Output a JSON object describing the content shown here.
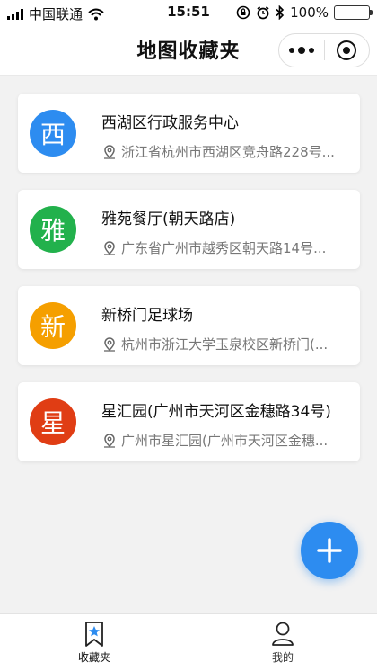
{
  "status_bar": {
    "carrier": "中国联通",
    "time": "15:51",
    "battery": "100%",
    "battery_level": 1.0
  },
  "navbar": {
    "title": "地图收藏夹"
  },
  "places": [
    {
      "initial": "西",
      "color": "#2d8cf0",
      "name": "西湖区行政服务中心",
      "address": "浙江省杭州市西湖区竞舟路228号..."
    },
    {
      "initial": "雅",
      "color": "#22b14c",
      "name": "雅苑餐厅(朝天路店)",
      "address": "广东省广州市越秀区朝天路14号..."
    },
    {
      "initial": "新",
      "color": "#f59f00",
      "name": "新桥门足球场",
      "address": "杭州市浙江大学玉泉校区新桥门(..."
    },
    {
      "initial": "星",
      "color": "#e03d14",
      "name": "星汇园(广州市天河区金穗路34号)",
      "address": "广州市星汇园(广州市天河区金穗..."
    }
  ],
  "tabs": [
    {
      "label": "收藏夹",
      "icon": "bookmark-star-icon",
      "active": true
    },
    {
      "label": "我的",
      "icon": "user-icon",
      "active": false
    }
  ],
  "fab": {
    "icon": "plus-icon"
  }
}
